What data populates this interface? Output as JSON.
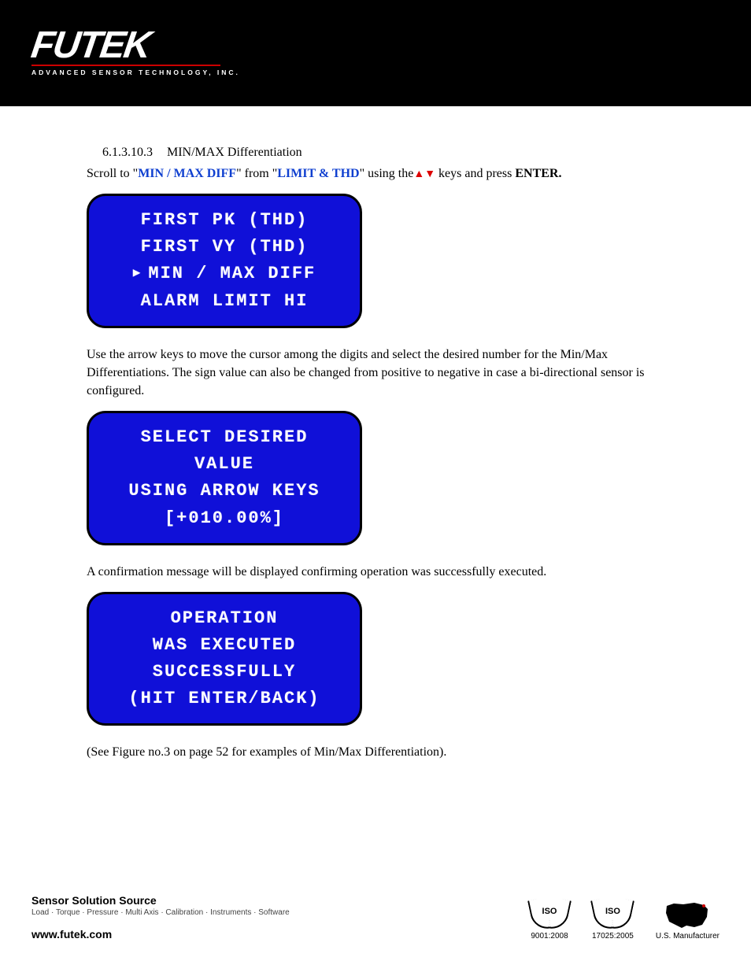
{
  "header": {
    "logo_main": "FUTEK",
    "logo_sub": "ADVANCED SENSOR TECHNOLOGY, INC."
  },
  "section": {
    "number": "6.1.3.10.3",
    "title": "MIN/MAX Differentiation",
    "intro_pre": "Scroll to \"",
    "intro_term1": "MIN / MAX DIFF",
    "intro_mid": "\" from \"",
    "intro_term2": "LIMIT & THD",
    "intro_post1": "\" using the",
    "intro_post2": " keys and press ",
    "intro_enter": "ENTER."
  },
  "lcd1": {
    "r1": "FIRST PK (THD)",
    "r2": "FIRST VY (THD)",
    "r3": "MIN / MAX DIFF",
    "r4": "ALARM LIMIT HI"
  },
  "para2": "Use the arrow keys to move the cursor among the digits and select the desired number for the Min/Max Differentiations. The sign value can also be changed from positive to negative in case a bi-directional sensor is configured.",
  "lcd2": {
    "r1": "SELECT DESIRED",
    "r2": "VALUE",
    "r3": "USING ARROW KEYS",
    "r4": "[+010.00%]"
  },
  "para3": "A confirmation message will be displayed confirming operation was successfully executed.",
  "lcd3": {
    "r1": "OPERATION",
    "r2": "WAS EXECUTED",
    "r3": "SUCCESSFULLY",
    "r4": "(HIT ENTER/BACK)"
  },
  "para4": "(See Figure no.3 on page 52 for examples of Min/Max Differentiation).",
  "footer": {
    "title": "Sensor Solution Source",
    "sub": "Load · Torque · Pressure · Multi Axis · Calibration · Instruments · Software",
    "url": "www.futek.com",
    "iso1": "9001:2008",
    "iso2": "17025:2005",
    "us": "U.S. Manufacturer",
    "iso_label": "ISO"
  }
}
